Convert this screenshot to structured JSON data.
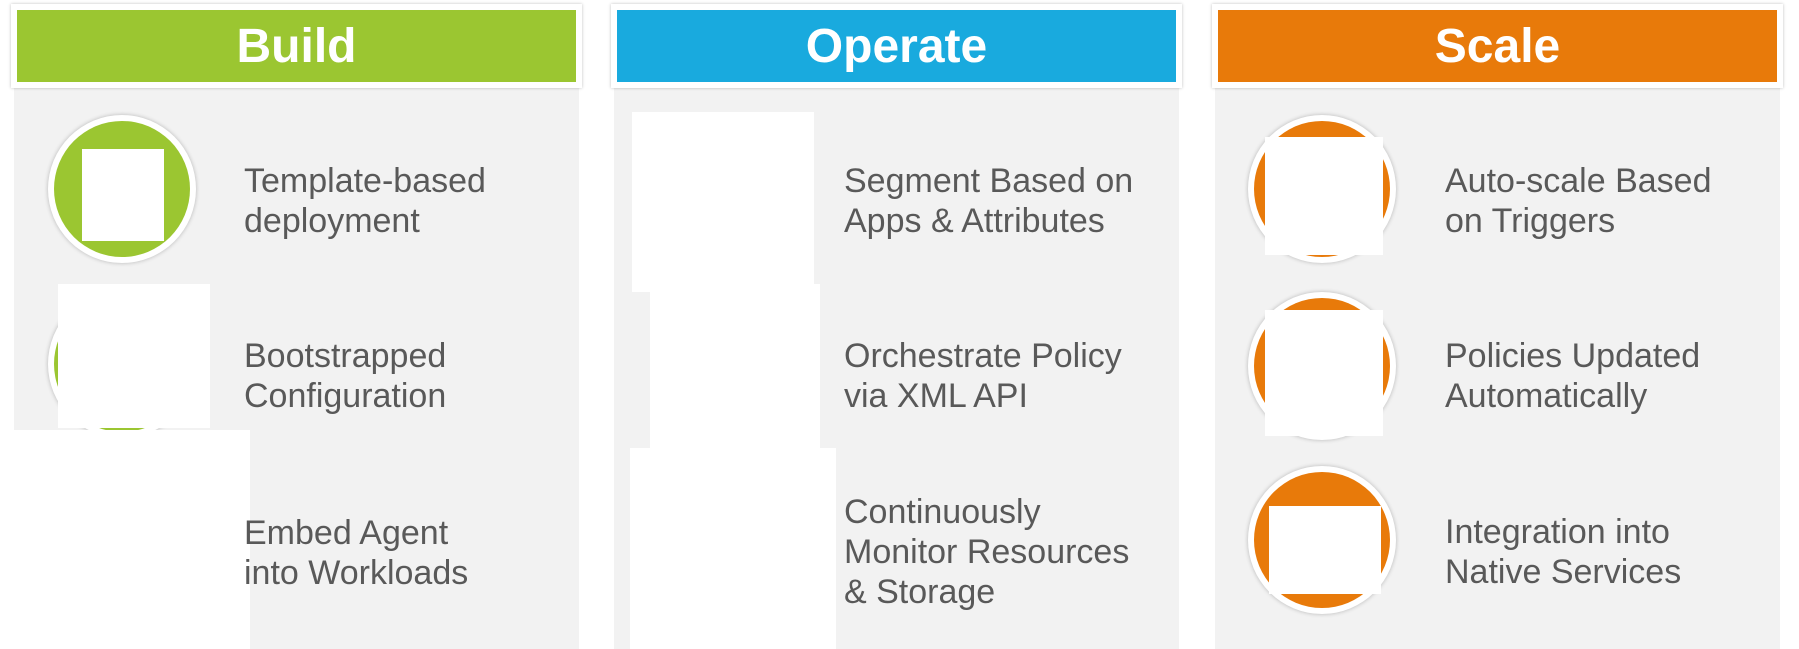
{
  "columns": [
    {
      "title": "Build",
      "color": "#9bc631",
      "items": [
        {
          "label": "Template-based\ndeployment",
          "icon": "template-icon"
        },
        {
          "label": "Bootstrapped\nConfiguration",
          "icon": "bootstrap-icon"
        },
        {
          "label": "Embed Agent\ninto Workloads",
          "icon": "agent-icon"
        }
      ]
    },
    {
      "title": "Operate",
      "color": "#19aade",
      "items": [
        {
          "label": "Segment Based on\nApps & Attributes",
          "icon": "segment-icon"
        },
        {
          "label": "Orchestrate Policy\nvia XML API",
          "icon": "orchestrate-icon"
        },
        {
          "label": "Continuously\nMonitor Resources\n& Storage",
          "icon": "monitor-icon"
        }
      ]
    },
    {
      "title": "Scale",
      "color": "#e87a0a",
      "items": [
        {
          "label": "Auto-scale Based\non Triggers",
          "icon": "autoscale-icon"
        },
        {
          "label": "Policies Updated\nAutomatically",
          "icon": "policy-update-icon"
        },
        {
          "label": "Integration into\nNative Services",
          "icon": "integration-icon"
        }
      ]
    }
  ]
}
